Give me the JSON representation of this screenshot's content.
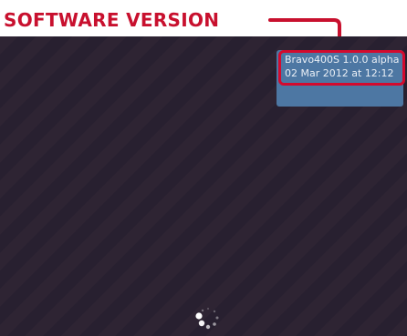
{
  "annotation": {
    "title": "SOFTWARE VERSION",
    "color": "#c8102e"
  },
  "version_box": {
    "line1": "Bravo400S 1.0.0 alpha",
    "line2": "02 Mar 2012 at 12:12",
    "background": "#4d77a3",
    "highlight_color": "#d40a2e"
  },
  "screen": {
    "background": "#2b2130",
    "loading_indicator": "loading-spinner-icon"
  }
}
